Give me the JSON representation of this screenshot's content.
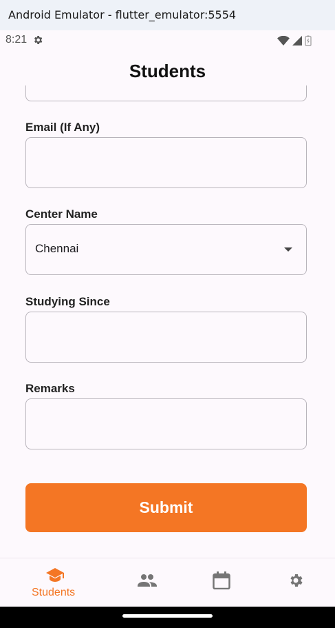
{
  "window": {
    "title": "Android Emulator - flutter_emulator:5554"
  },
  "status_bar": {
    "time": "8:21",
    "icons": [
      "settings-icon",
      "wifi-icon",
      "signal-icon",
      "battery-icon"
    ]
  },
  "app_bar": {
    "title": "Students"
  },
  "form": {
    "email": {
      "label": "Email (If Any)",
      "value": ""
    },
    "center_name": {
      "label": "Center Name",
      "selected": "Chennai"
    },
    "studying_since": {
      "label": "Studying Since",
      "value": ""
    },
    "remarks": {
      "label": "Remarks",
      "value": ""
    },
    "submit_label": "Submit"
  },
  "bottom_nav": {
    "items": [
      {
        "icon": "graduation-cap-icon",
        "label": "Students",
        "active": true
      },
      {
        "icon": "people-icon",
        "label": "",
        "active": false
      },
      {
        "icon": "calendar-icon",
        "label": "",
        "active": false
      },
      {
        "icon": "settings-icon",
        "label": "",
        "active": false
      }
    ]
  },
  "colors": {
    "accent": "#f47624",
    "background": "#fdf9fd",
    "field_border": "#b8b4bb",
    "inactive_icon": "#757575"
  }
}
